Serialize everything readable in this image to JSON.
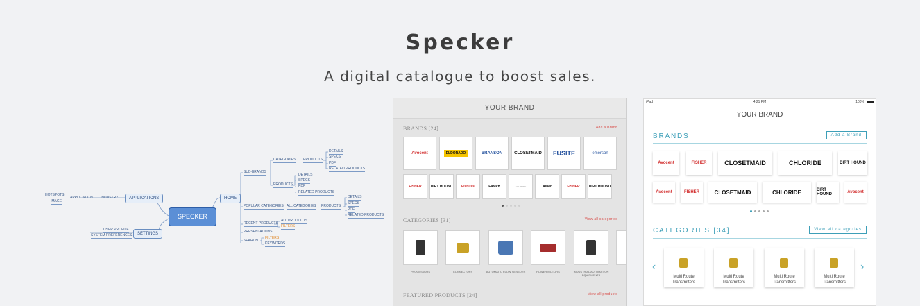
{
  "hero": {
    "title": "Specker",
    "subtitle": "A digital catalogue to boost sales."
  },
  "mindmap": {
    "center": "SPECKER",
    "nodes": {
      "hotspots": "HOTSPOTS",
      "image": "IMAGE",
      "application": "APPLICATION",
      "industry": "INDUSTRY",
      "applications": "APPLICATIONS",
      "user_profile": "USER PROFILE",
      "system_preferences": "SYSTEM PREFERENCES",
      "settings": "SETTINGS",
      "home": "HOME",
      "sub_brands": "SUB-BRANDS",
      "categories": "CATEGORIES",
      "products1": "PRODUCTS",
      "details1": "DETAILS",
      "specs1": "SPECS",
      "pdf1": "PDF",
      "related1": "RELATED PRODUCTS",
      "products2": "PRODUCTS",
      "details2": "DETAILS",
      "specs2": "SPECS",
      "pdf2": "PDF",
      "related2": "RELATED PRODUCTS",
      "popular_categories": "POPULAR CATEGORIES",
      "all_categories": "ALL CATEGORIES",
      "products3": "PRODUCTS",
      "details3": "DETAILS",
      "specs3": "SPECS",
      "pdf3": "PDF",
      "related3": "RELATED PRODUCTS",
      "recent_products": "RECENT PRODUCTS",
      "all_products": "ALL PRODUCTS",
      "filters1": "FILTERS",
      "presentations": "PRESENTATIONS",
      "search": "SEARCH",
      "filters2": "FILTERS",
      "keywords": "KEYWORDS"
    }
  },
  "tablet1": {
    "title": "YOUR BRAND",
    "brands_label": "BRANDS [24]",
    "add_brand": "Add a Brand",
    "brands_row1": [
      "Avocent",
      "ELDORADO",
      "BRANSON",
      "CLOSETMAID",
      "FUSITE",
      "emerson"
    ],
    "brands_row2": [
      "FISHER",
      "DIRT HOUND",
      "Fixbuss",
      "Eatech",
      "CHLORIDE",
      "Alber",
      "FISHER",
      "DIRT HOUND"
    ],
    "categories_label": "CATEGORIES [31]",
    "view_all_categories": "View all categories",
    "categories": [
      "PROCESSORS",
      "CONNECTORS",
      "AUTOMATIC FLOW SENSORS",
      "POWER MOTORS",
      "INDUSTRIAL AUTOMATION EQUIPMENTS"
    ],
    "featured_label": "FEATURED PRODUCTS [24]",
    "view_all_products": "View all products"
  },
  "tablet2": {
    "status_left": "iPad",
    "status_time": "4:21 PM",
    "status_battery": "100%",
    "title": "YOUR BRAND",
    "brands_label": "BRANDS",
    "add_brand_button": "Add a Brand",
    "brands_row1": [
      "Avocent",
      "FISHER",
      "CLOSETMAID",
      "CHLORIDE",
      "DIRT HOUND"
    ],
    "brands_row2": [
      "Avocent",
      "FISHER",
      "CLOSETMAID",
      "CHLORIDE",
      "DIRT HOUND",
      "Avocent"
    ],
    "categories_label": "CATEGORIES [34]",
    "view_all_button": "View all categories",
    "categories": [
      "Multi Route Transmitters",
      "Multi Route Transmitters",
      "Multi Route Transmitters",
      "Multi Route Transmitters"
    ]
  },
  "colors": {
    "accent_teal": "#3d9fb8",
    "accent_red": "#d12a2a",
    "mindmap_blue": "#5b8fd6"
  }
}
